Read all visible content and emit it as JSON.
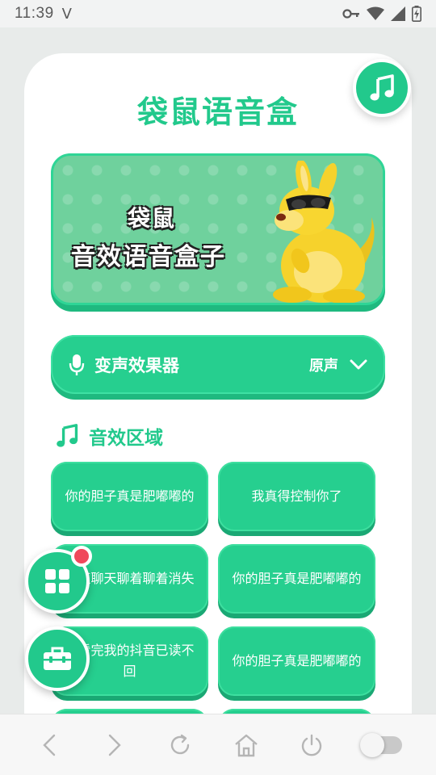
{
  "status_bar": {
    "time": "11:39",
    "carrier_icon": "V"
  },
  "app": {
    "title": "袋鼠语音盒"
  },
  "banner": {
    "line1": "袋鼠",
    "line2": "音效语音盒子"
  },
  "voice_changer": {
    "label": "变声效果器",
    "selected_value": "原声"
  },
  "section": {
    "title": "音效区域"
  },
  "sounds": [
    "你的胆子真是肥嘟嘟的",
    "我真得控制你了",
    "一直聊天聊着聊着消失",
    "你的胆子真是肥嘟嘟的",
    "你看完我的抖音已读不回",
    "你的胆子真是肥嘟嘟的"
  ],
  "colors": {
    "accent": "#22c98c",
    "accent_dark": "#1fb97f",
    "badge": "#f0485b"
  },
  "icons": {
    "music_fab": "music-note-icon",
    "mic": "microphone-icon",
    "grid": "grid-apps-icon",
    "toolbox": "toolbox-icon"
  }
}
